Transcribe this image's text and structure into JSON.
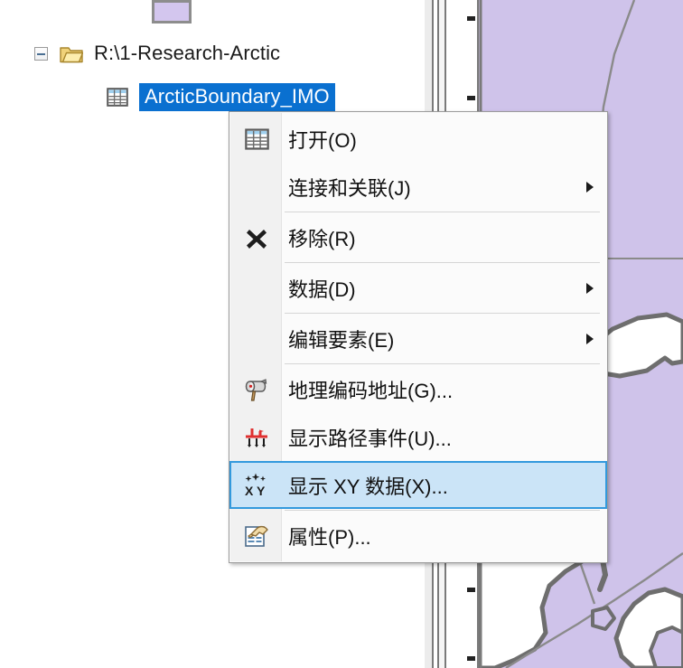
{
  "app": {
    "context": "ArcGIS table of contents with right-click context menu"
  },
  "toc": {
    "legend_swatch": {
      "name": "polygon-symbol-swatch",
      "fill": "#d3c6ee",
      "outline": "#8d8d8d"
    },
    "items": [
      {
        "id": "folder",
        "label": "R:\\1-Research-Arctic",
        "icon": "folder-icon",
        "expander": "collapse-minus",
        "expanded": true,
        "selected": false
      },
      {
        "id": "table",
        "label": "ArcticBoundary_IMO",
        "icon": "table-icon",
        "expander": null,
        "expanded": false,
        "selected": true
      }
    ]
  },
  "context_menu": {
    "selected_index": 7,
    "items": [
      {
        "label": "打开(O)",
        "icon": "table-icon",
        "submenu": false,
        "separator_after": false,
        "selected": false
      },
      {
        "label": "连接和关联(J)",
        "icon": null,
        "submenu": true,
        "separator_after": true,
        "selected": false
      },
      {
        "label": "移除(R)",
        "icon": "remove-x-icon",
        "submenu": false,
        "separator_after": true,
        "selected": false
      },
      {
        "label": "数据(D)",
        "icon": null,
        "submenu": true,
        "separator_after": true,
        "selected": false
      },
      {
        "label": "编辑要素(E)",
        "icon": null,
        "submenu": true,
        "separator_after": true,
        "selected": false
      },
      {
        "label": "地理编码地址(G)...",
        "icon": "geocode-mailbox-icon",
        "submenu": false,
        "separator_after": false,
        "selected": false
      },
      {
        "label": "显示路径事件(U)...",
        "icon": "route-events-icon",
        "submenu": false,
        "separator_after": false,
        "selected": false
      },
      {
        "label": "显示 XY 数据(X)...",
        "icon": "xy-data-icon",
        "submenu": false,
        "separator_after": true,
        "selected": true
      },
      {
        "label": "属性(P)...",
        "icon": "properties-icon",
        "submenu": false,
        "separator_after": false,
        "selected": false
      }
    ],
    "colors": {
      "background": "#fbfbfb",
      "gutter": "#f1f1f1",
      "selection_fill": "#cbe4f7",
      "selection_border": "#3399dd",
      "border": "#9a9a9a",
      "separator": "#d6d6d6"
    }
  },
  "map": {
    "polygon_fill": "#cfc3ea",
    "land_fill": "#ffffff",
    "coastline_stroke": "#6e6e6e",
    "graticule_stroke": "#8a8a8a"
  },
  "ruler": {
    "name": "vertical-scale-ruler",
    "tick_positions": [
      18,
      106,
      216,
      320,
      430,
      540,
      650,
      726
    ]
  },
  "selection": {
    "tree_highlight": "#0a70d0"
  }
}
